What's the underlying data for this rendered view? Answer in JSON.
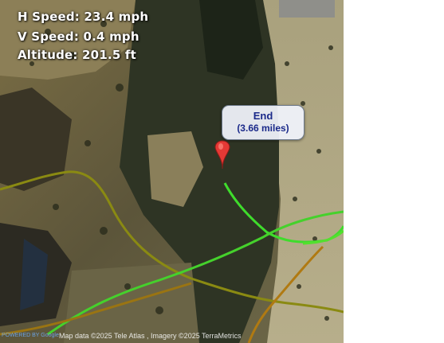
{
  "hud": {
    "h_speed": "H Speed: 23.4 mph",
    "v_speed": "V Speed: 0.4 mph",
    "altitude": "Altitude: 201.5 ft"
  },
  "marker": {
    "title": "End",
    "distance": "(3.66 miles)",
    "color": "#e53935"
  },
  "map": {
    "attribution": "Map data ©2025 Tele Atlas , Imagery ©2025 TerraMetrics",
    "brand": "POWERED BY Google",
    "track_colors": [
      "#b06b10",
      "#8c8a10",
      "#3fdc2c"
    ]
  }
}
